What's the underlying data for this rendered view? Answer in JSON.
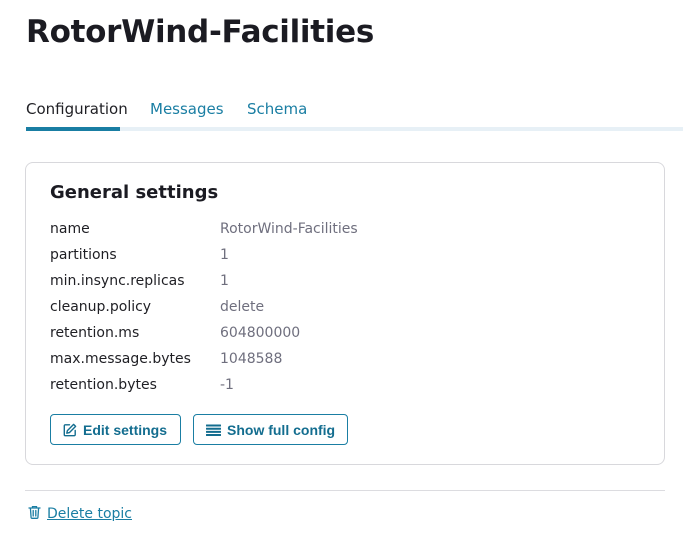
{
  "page": {
    "title": "RotorWind-Facilities"
  },
  "tabs": [
    {
      "label": "Configuration",
      "active": true
    },
    {
      "label": "Messages",
      "active": false
    },
    {
      "label": "Schema",
      "active": false
    }
  ],
  "general_settings": {
    "title": "General settings",
    "rows": [
      {
        "key": "name",
        "value": "RotorWind-Facilities"
      },
      {
        "key": "partitions",
        "value": "1"
      },
      {
        "key": "min.insync.replicas",
        "value": "1"
      },
      {
        "key": "cleanup.policy",
        "value": "delete"
      },
      {
        "key": "retention.ms",
        "value": "604800000"
      },
      {
        "key": "max.message.bytes",
        "value": "1048588"
      },
      {
        "key": "retention.bytes",
        "value": "-1"
      }
    ],
    "edit_button": {
      "label": "Edit settings",
      "icon": "edit-icon"
    },
    "full_config_button": {
      "label": "Show full config",
      "icon": "list-icon"
    }
  },
  "delete_topic": {
    "label": "Delete topic",
    "icon": "trash-icon"
  },
  "colors": {
    "accent": "#1a7ea3",
    "tab_track": "#e7f0f6",
    "value_text": "#6f6f7e",
    "card_border": "#d8d8dc"
  }
}
